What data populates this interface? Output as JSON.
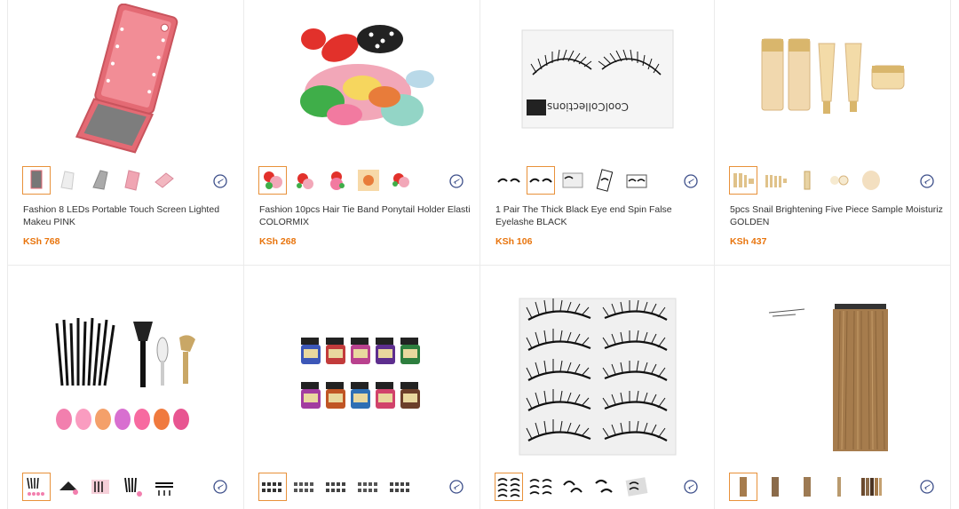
{
  "products": [
    {
      "title": "Fashion 8 LEDs Portable Touch Screen Lighted Makeu PINK",
      "price": "KSh 768",
      "image": "led-makeup-mirror",
      "thumbs": [
        "mirror-grey",
        "mirror-white",
        "mirror-silver",
        "mirror-pink",
        "mirror-pink-light"
      ],
      "selected_thumb": 0
    },
    {
      "title": "Fashion 10pcs Hair Tie Band Ponytail Holder Elasti COLORMIX",
      "price": "KSh 268",
      "image": "hair-tie-bands",
      "thumbs": [
        "hairtie-mix",
        "hairtie-mix",
        "hairtie-mix",
        "hairtie-yellow",
        "hairtie-mix"
      ],
      "selected_thumb": 0
    },
    {
      "title": "1 Pair The Thick Black Eye end Spin False Eyelashe BLACK",
      "price": "KSh 106",
      "image": "false-eyelashes-box",
      "thumbs": [
        "lashes-pair",
        "lashes-pair",
        "lashes-box",
        "lashes-card",
        "lashes-case"
      ],
      "selected_thumb": 1
    },
    {
      "title": "5pcs Snail Brightening Five Piece Sample Moisturiz GOLDEN",
      "price": "KSh 437",
      "image": "snail-cream-set",
      "thumbs": [
        "cream-set",
        "cream-set",
        "cream-bottle",
        "cream-pads",
        "cream-mask"
      ],
      "selected_thumb": 0
    },
    {
      "title": "",
      "price": "",
      "image": "makeup-brush-set",
      "thumbs": [
        "brush-set",
        "brush-fan",
        "brush-kit",
        "brush-black",
        "brush-black"
      ],
      "selected_thumb": 0
    },
    {
      "title": "",
      "price": "",
      "image": "ink-bottles",
      "thumbs": [
        "ink-row",
        "ink-row",
        "ink-row",
        "ink-row",
        "ink-row"
      ],
      "selected_thumb": 0
    },
    {
      "title": "",
      "price": "",
      "image": "eyelash-strips",
      "thumbs": [
        "lash-strips",
        "lash-strips",
        "lash-curl",
        "lash-pair",
        "lash-box"
      ],
      "selected_thumb": 0
    },
    {
      "title": "",
      "price": "",
      "image": "hair-extension",
      "thumbs": [
        "hair-brown",
        "hair-brown",
        "hair-brown",
        "hair-thin",
        "hair-swatch"
      ],
      "selected_thumb": 0
    }
  ],
  "colors": {
    "price": "#e8740c",
    "selected_border": "#e8913a",
    "ship_icon": "#3d4f8a"
  },
  "icons": {
    "ship": "airplane-shipping-icon"
  }
}
